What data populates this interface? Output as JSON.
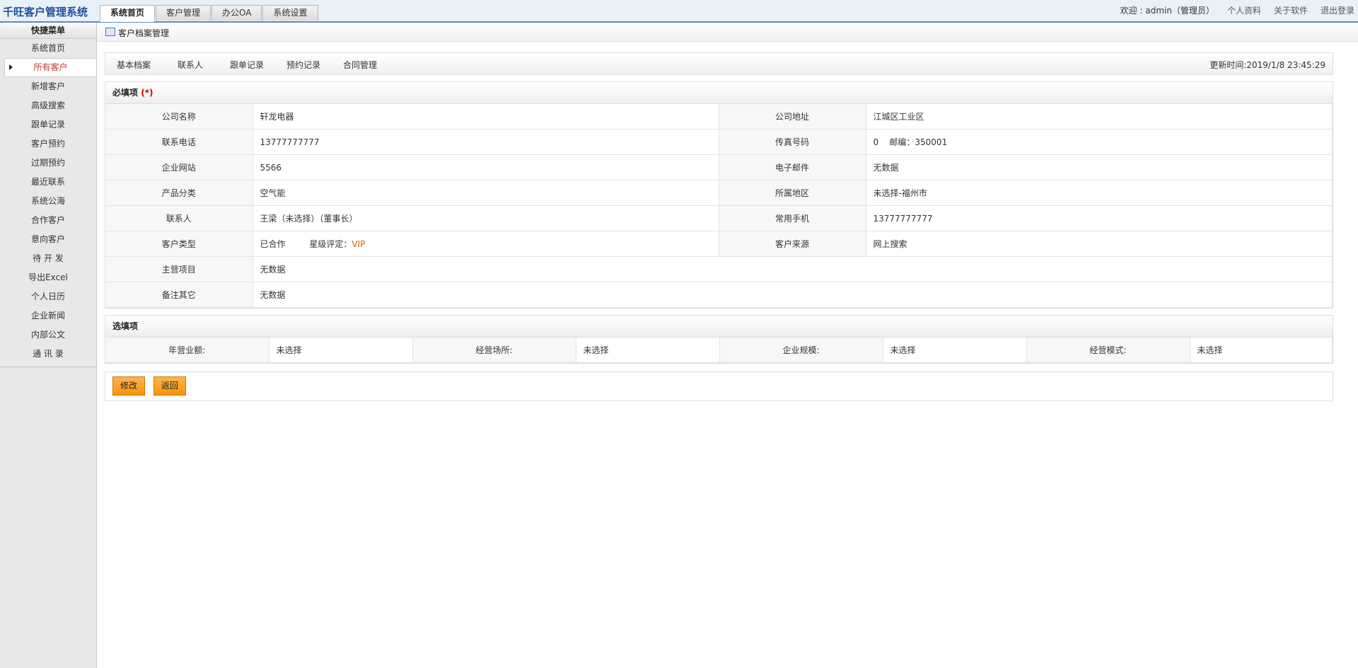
{
  "app_title": "千旺客户管理系统",
  "tabs": [
    {
      "label": "系统首页",
      "active": true
    },
    {
      "label": "客户管理",
      "active": false
    },
    {
      "label": "办公OA",
      "active": false
    },
    {
      "label": "系统设置",
      "active": false
    }
  ],
  "top_right": {
    "welcome": "欢迎 : admin（管理员）",
    "profile": "个人资料",
    "about": "关于软件",
    "logout": "退出登录"
  },
  "sidebar": {
    "header": "快捷菜单",
    "items": [
      {
        "label": "系统首页"
      },
      {
        "label": "所有客户",
        "active": true
      },
      {
        "label": "新增客户"
      },
      {
        "label": "高级搜索"
      },
      {
        "label": "跟单记录"
      },
      {
        "label": "客户预约"
      },
      {
        "label": "过期预约"
      },
      {
        "label": "最近联系"
      },
      {
        "label": "系统公海"
      },
      {
        "label": "合作客户"
      },
      {
        "label": "意向客户"
      },
      {
        "label": "待 开 发"
      },
      {
        "label": "导出Excel"
      },
      {
        "label": "个人日历"
      },
      {
        "label": "企业新闻"
      },
      {
        "label": "内部公文"
      },
      {
        "label": "通 讯 录"
      }
    ]
  },
  "main": {
    "title": "客户档案管理",
    "subtabs": [
      "基本档案",
      "联系人",
      "跟单记录",
      "预约记录",
      "合同管理"
    ],
    "update_time": "更新时间:2019/1/8 23:45:29",
    "required": {
      "title": "必填项",
      "mark": "(*)",
      "fields": {
        "company_name": {
          "label": "公司名称",
          "value": "轩龙电器"
        },
        "company_address": {
          "label": "公司地址",
          "value": "江城区工业区"
        },
        "phone": {
          "label": "联系电话",
          "value": "13777777777"
        },
        "fax": {
          "label": "传真号码",
          "value": "0    邮编：350001"
        },
        "website": {
          "label": "企业网站",
          "value": "5566"
        },
        "email": {
          "label": "电子邮件",
          "value": "无数据"
        },
        "category": {
          "label": "产品分类",
          "value": "空气能"
        },
        "region": {
          "label": "所属地区",
          "value": "未选择-福州市"
        },
        "contact": {
          "label": "联系人",
          "value": "王梁（未选择）（董事长）"
        },
        "mobile": {
          "label": "常用手机",
          "value": "13777777777"
        },
        "customer_type": {
          "label": "客户类型",
          "value": "已合作",
          "star_label": "星级评定：",
          "star_value": "VIP"
        },
        "source": {
          "label": "客户来源",
          "value": "网上搜索"
        },
        "main_business": {
          "label": "主营项目",
          "value": "无数据"
        },
        "remarks": {
          "label": "备注其它",
          "value": "无数据"
        }
      }
    },
    "optional": {
      "title": "选填项",
      "fields": [
        {
          "label": "年营业额:",
          "value": "未选择"
        },
        {
          "label": "经营场所:",
          "value": "未选择"
        },
        {
          "label": "企业规模:",
          "value": "未选择"
        },
        {
          "label": "经营模式:",
          "value": "未选择"
        }
      ]
    },
    "buttons": {
      "edit": "修改",
      "back": "返回"
    }
  },
  "colors": {
    "accent": "#1f4fa0",
    "button": "#f89406",
    "vip": "#e05a00",
    "active_menu": "#c0392b"
  }
}
